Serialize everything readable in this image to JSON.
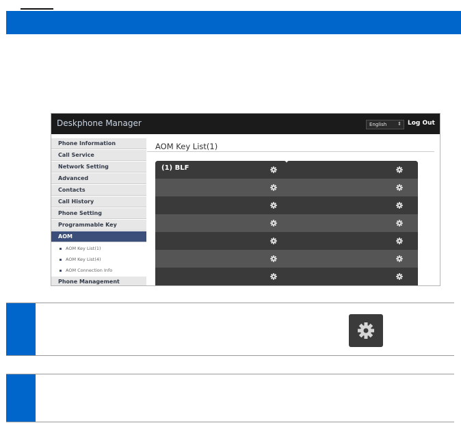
{
  "app": {
    "title": "Deskphone Manager",
    "language": "English",
    "logout_label": "Log Out"
  },
  "sidebar": {
    "items": [
      {
        "label": "Phone Information"
      },
      {
        "label": "Call Service"
      },
      {
        "label": "Network Setting"
      },
      {
        "label": "Advanced"
      },
      {
        "label": "Contacts"
      },
      {
        "label": "Call History"
      },
      {
        "label": "Phone Setting"
      },
      {
        "label": "Programmable Key"
      },
      {
        "label": "AOM"
      }
    ],
    "sub_items": [
      {
        "label": "AOM Key List(1)"
      },
      {
        "label": "AOM Key List(4)"
      },
      {
        "label": "AOM Connection Info"
      }
    ],
    "last_item": {
      "label": "Phone Management"
    },
    "active": "AOM"
  },
  "main": {
    "title": "AOM Key List(1)",
    "key_panels": [
      {
        "keys": [
          "(1) BLF",
          "",
          "",
          "",
          "",
          "",
          ""
        ]
      },
      {
        "keys": [
          "",
          "",
          "",
          "",
          "",
          "",
          ""
        ]
      }
    ]
  },
  "icons": {
    "key_setting": "gear-icon",
    "callout_button": "gear-icon"
  },
  "colors": {
    "accent_blue": "#0066cc",
    "sidebar_active": "#3c4e7a",
    "header_dark": "#1b1b1b"
  }
}
